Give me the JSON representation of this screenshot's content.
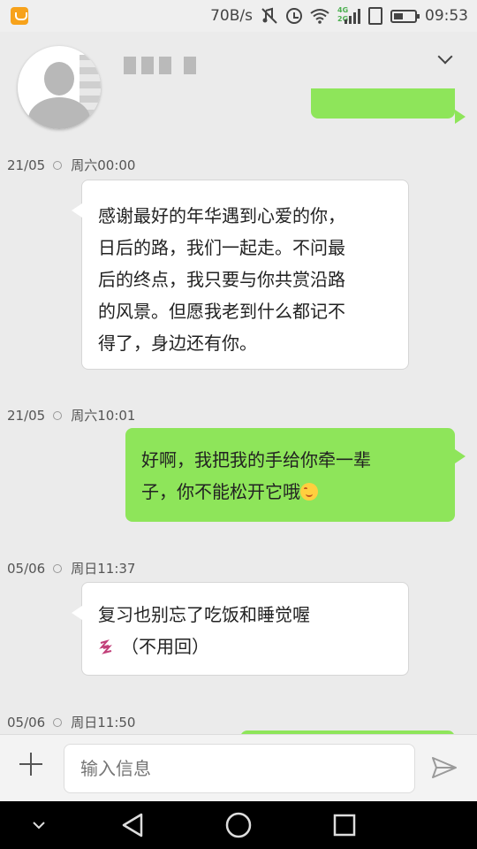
{
  "status_bar": {
    "speed": "70B/s",
    "network_labels": [
      "4G",
      "2G"
    ],
    "time": "09:53"
  },
  "messages": [
    {
      "timestamp_date": "21/05",
      "timestamp_day": "周六00:00",
      "side": "incoming",
      "lines": [
        "感谢最好的年华遇到心爱的你，",
        "日后的路，我们一起走。不问最",
        "后的终点，我只要与你共赏沿路",
        "的风景。但愿我老到什么都记不",
        "得了，身边还有你。"
      ]
    },
    {
      "timestamp_date": "21/05",
      "timestamp_day": "周六10:01",
      "side": "outgoing",
      "lines": [
        "好啊，我把我的手给你牵一辈",
        "子，你不能松开它哦"
      ],
      "emoji": "smile-emoji"
    },
    {
      "timestamp_date": "05/06",
      "timestamp_day": "周日11:37",
      "side": "incoming",
      "lines": [
        "复习也别忘了吃饭和睡觉喔",
        "（不用回）"
      ],
      "emoji": "sleep-zzz-emoji"
    },
    {
      "timestamp_date": "05/06",
      "timestamp_day": "周日11:50"
    }
  ],
  "input": {
    "placeholder": "输入信息"
  },
  "icons": {
    "statusbar_app": "app-notification-icon",
    "mute": "mute-icon",
    "alarm": "alarm-icon",
    "wifi": "wifi-icon",
    "signal": "signal-icon",
    "sim": "sim-icon",
    "battery": "battery-icon",
    "dropdown": "chevron-down-icon",
    "plus": "plus-icon",
    "send": "send-icon",
    "nav_hide": "chevron-down-icon",
    "nav_back": "back-icon",
    "nav_home": "home-icon",
    "nav_recent": "recent-apps-icon"
  },
  "colors": {
    "outgoing_bubble": "#8ee55a",
    "incoming_bubble": "#ffffff",
    "background": "#ebebeb"
  }
}
